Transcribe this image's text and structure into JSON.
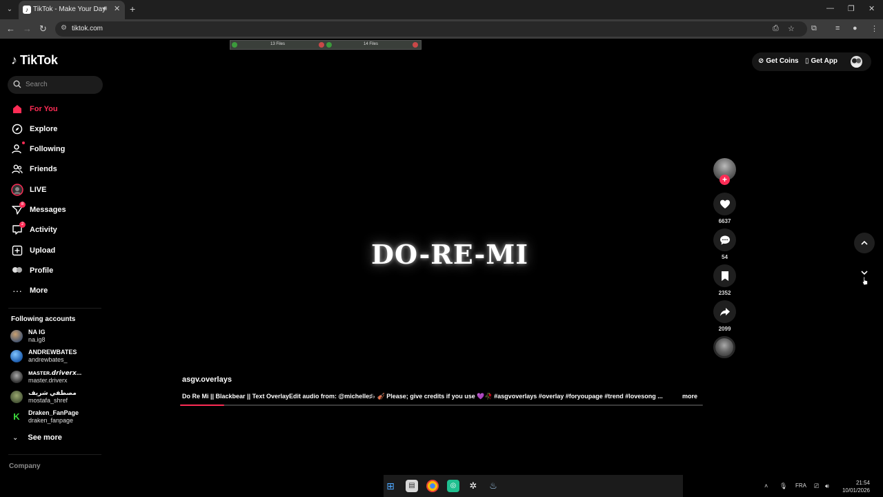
{
  "browser": {
    "tab_title": "TikTok - Make Your Day",
    "address": "tiktok.com"
  },
  "files_strip": {
    "left_label": "13 Files",
    "right_label": "14 Files"
  },
  "brand": {
    "logo_text": "TikTok",
    "accent_color": "#fe2c55"
  },
  "search": {
    "placeholder": "Search"
  },
  "nav": [
    {
      "label": "For You",
      "icon": "home-icon",
      "active": true
    },
    {
      "label": "Explore",
      "icon": "compass-icon"
    },
    {
      "label": "Following",
      "icon": "following-icon"
    },
    {
      "label": "Friends",
      "icon": "friends-icon"
    },
    {
      "label": "LIVE",
      "icon": "live-icon"
    },
    {
      "label": "Messages",
      "icon": "messages-icon",
      "badge": "8"
    },
    {
      "label": "Activity",
      "icon": "activity-icon",
      "badge": "2"
    },
    {
      "label": "Upload",
      "icon": "upload-icon"
    },
    {
      "label": "Profile",
      "icon": "profile-icon"
    },
    {
      "label": "More",
      "icon": "more-icon"
    }
  ],
  "following": {
    "title": "Following accounts",
    "accounts": [
      {
        "name": "NA IG",
        "handle": "na.ig8"
      },
      {
        "name": "ANDREWBATES",
        "handle": "andrewbates_"
      },
      {
        "name": "ᴍᴀsᴛᴇʀ.𝙙𝙧𝙞𝙫𝙚𝙧𝙭...",
        "handle": "master.driverx"
      },
      {
        "name": "مصطفي شريف",
        "handle": "mostafa_shref"
      },
      {
        "name": "Draken_FanPage",
        "handle": "draken_fanpage"
      }
    ],
    "see_more": "See more"
  },
  "footer": {
    "company": "Company"
  },
  "top_right": {
    "get_coins": "Get Coins",
    "get_app": "Get App"
  },
  "video": {
    "title": "DO-RE-MI",
    "author": "asgv.overlays",
    "caption": "Do Re Mi || Blackbear || Text OverlayEdit audio from: @michelle♯♭ 🎻 Please; give credits if you use 💜🥀 #asgvoverlays #overlay #foryoupage #trend #lovesong ...",
    "more": "more",
    "progress": 0.085
  },
  "actions": {
    "likes": "6637",
    "comments": "54",
    "saves": "2352",
    "shares": "2099"
  },
  "system": {
    "lang": "FRA",
    "time": "21:54",
    "date": "10/01/2026"
  }
}
